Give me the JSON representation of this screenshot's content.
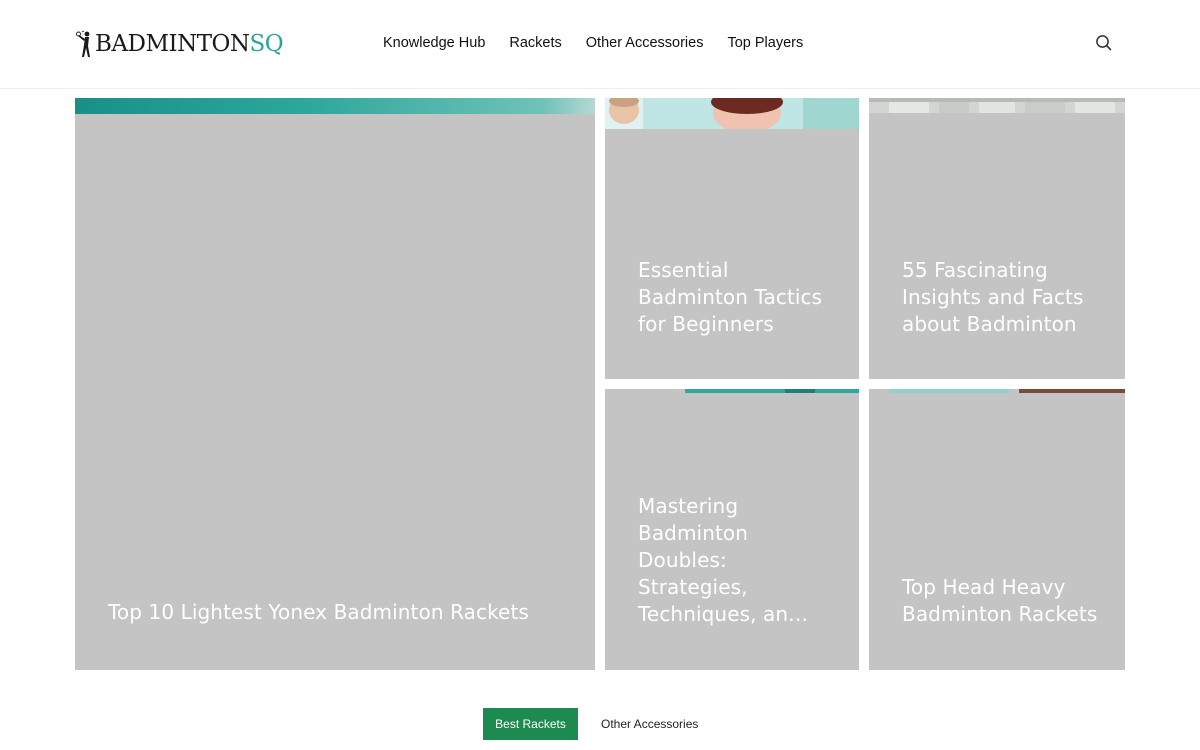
{
  "header": {
    "logo": {
      "main": "BADMINTON",
      "accent": "SQ"
    },
    "nav": [
      "Knowledge Hub",
      "Rackets",
      "Other Accessories",
      "Top Players"
    ],
    "search_icon": "search-icon"
  },
  "posts": {
    "main": {
      "title": "Top 10 Lightest Yonex Badminton Rackets"
    },
    "tactics": {
      "title_lines": [
        "Essential",
        "Badminton Tactics",
        "for Beginners"
      ]
    },
    "facts": {
      "title_lines": [
        "55 Fascinating",
        "Insights and Facts",
        "about Badminton"
      ]
    },
    "doubles": {
      "title_lines": [
        "Mastering",
        "Badminton",
        "Doubles:",
        "Strategies,",
        "Techniques, an…"
      ]
    },
    "heavy": {
      "title_lines": [
        "Top Head Heavy",
        "Badminton Rackets"
      ]
    }
  },
  "tabs": {
    "active": "Best Rackets",
    "other": "Other Accessories"
  },
  "colors": {
    "accent": "#2aa39a",
    "tab_active": "#1d8a4f",
    "placeholder": "#c4c4c4"
  }
}
